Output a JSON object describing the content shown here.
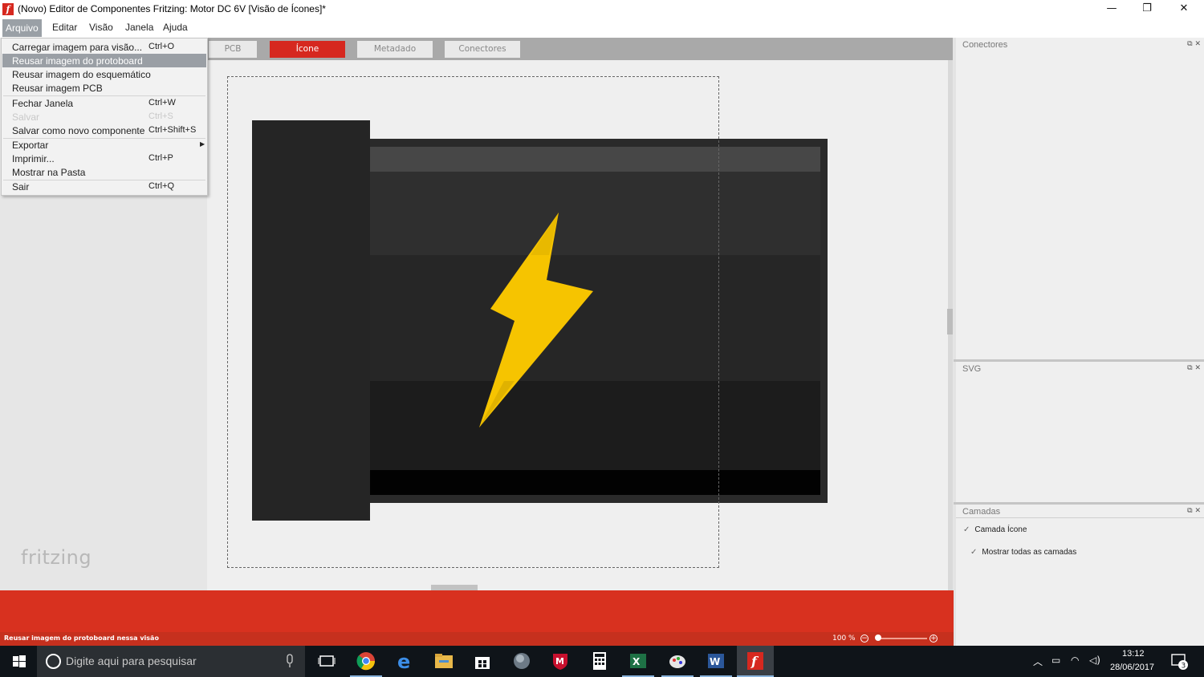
{
  "window": {
    "title": "(Novo) Editor de Componentes Fritzing: Motor DC 6V [Visão de Ícones]*",
    "minimize": "—",
    "maximize": "❐",
    "close": "✕"
  },
  "menubar": {
    "items": [
      "Arquivo",
      "Editar",
      "Visão",
      "Janela",
      "Ajuda"
    ]
  },
  "file_menu": {
    "items": [
      {
        "label": "Carregar imagem para visão...",
        "shortcut": "Ctrl+O"
      },
      {
        "label": "Reusar imagem do protoboard",
        "shortcut": ""
      },
      {
        "label": "Reusar imagem do esquemático",
        "shortcut": ""
      },
      {
        "label": "Reusar imagem PCB",
        "shortcut": ""
      },
      {
        "label": "Fechar Janela",
        "shortcut": "Ctrl+W"
      },
      {
        "label": "Salvar",
        "shortcut": "Ctrl+S"
      },
      {
        "label": "Salvar como novo componente",
        "shortcut": "Ctrl+Shift+S"
      },
      {
        "label": "Exportar",
        "shortcut": ""
      },
      {
        "label": "Imprimir...",
        "shortcut": "Ctrl+P"
      },
      {
        "label": "Mostrar na Pasta",
        "shortcut": ""
      },
      {
        "label": "Sair",
        "shortcut": "Ctrl+Q"
      }
    ]
  },
  "tabs": [
    "PCB",
    "Ícone",
    "Metadado",
    "Conectores"
  ],
  "canvas": {
    "logo_text": "fritzing",
    "bolt_color": "#f6c400"
  },
  "status": {
    "message": "Reusar imagem do protoboard nessa visão",
    "zoom": "100 %"
  },
  "panels": {
    "connectors_title": "Conectores",
    "svg_title": "SVG",
    "layers_title": "Camadas",
    "layer_icon": "Camada Ícone",
    "show_all_layers": "Mostrar todas as camadas",
    "panel_controls": "⧉ ✕"
  },
  "taskbar": {
    "search_placeholder": "Digite aqui para pesquisar",
    "time": "13:12",
    "date": "28/06/2017",
    "notifications": "3"
  },
  "colors": {
    "accent": "#d6281f",
    "statusbar": "#c6301e"
  }
}
